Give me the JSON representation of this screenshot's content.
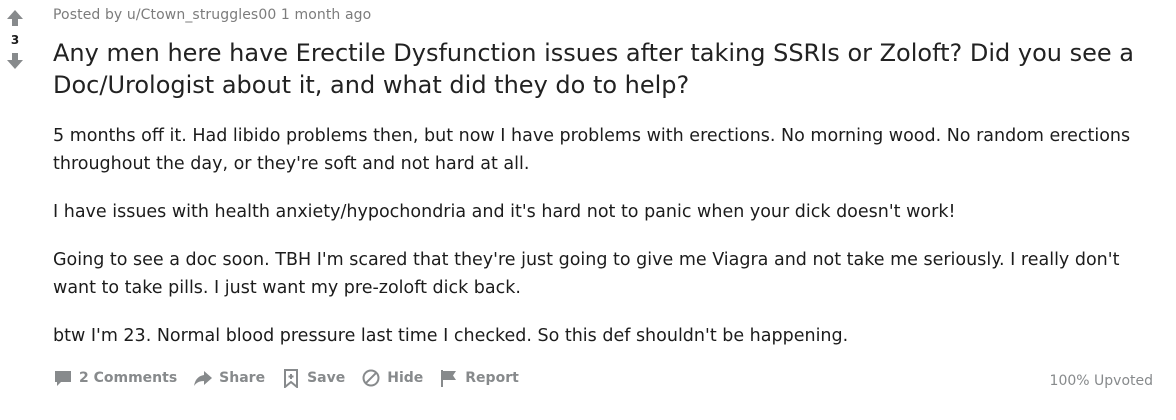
{
  "vote": {
    "count": "3"
  },
  "post": {
    "posted_by_prefix": "Posted by",
    "author": "u/Ctown_struggles00",
    "time": "1 month ago",
    "title": "Any men here have Erectile Dysfunction issues after taking SSRIs or Zoloft? Did you see a Doc/Urologist about it, and what did they do to help?",
    "paragraphs": [
      "5 months off it. Had libido problems then, but now I have problems with erections. No morning wood. No random erections throughout the day, or they're soft and not hard at all.",
      "I have issues with health anxiety/hypochondria and it's hard not to panic when your dick doesn't work!",
      "Going to see a doc soon. TBH I'm scared that they're just going to give me Viagra and not take me seriously. I really don't want to take pills. I just want my pre-zoloft dick back.",
      "btw I'm 23. Normal blood pressure last time I checked. So this def shouldn't be happening."
    ]
  },
  "actions": {
    "comments": "2 Comments",
    "share": "Share",
    "save": "Save",
    "hide": "Hide",
    "report": "Report"
  },
  "upvote_ratio": "100% Upvoted",
  "colors": {
    "meta": "#7c7c7c",
    "action": "#878a8c",
    "arrow": "#878a8c"
  },
  "icons": [
    "upvote-icon",
    "downvote-icon",
    "comment-icon",
    "share-icon",
    "save-icon",
    "hide-icon",
    "report-icon"
  ]
}
